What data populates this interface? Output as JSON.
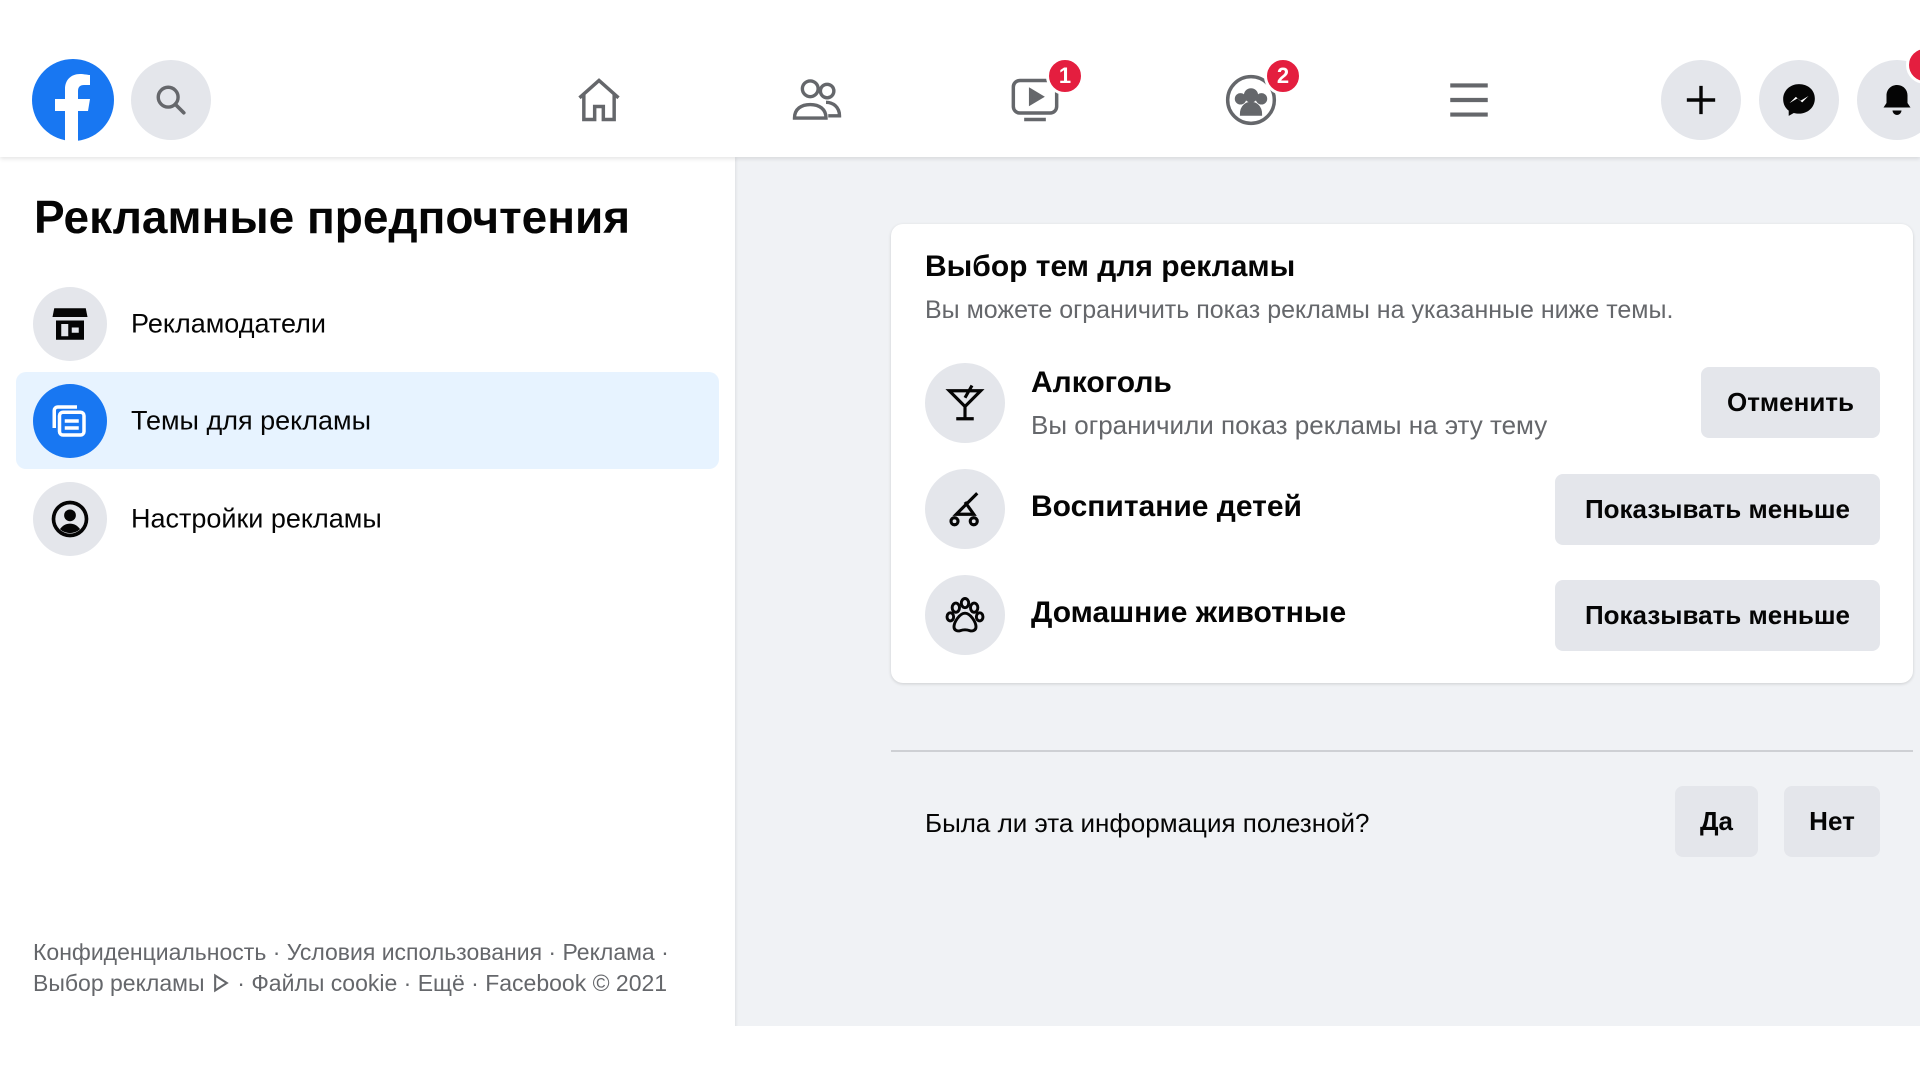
{
  "header": {
    "nav": [
      {
        "name": "home"
      },
      {
        "name": "friends"
      },
      {
        "name": "watch",
        "badge": "1"
      },
      {
        "name": "groups",
        "badge": "2"
      },
      {
        "name": "menu"
      }
    ]
  },
  "sidebar": {
    "title": "Рекламные предпочтения",
    "items": [
      {
        "label": "Рекламодатели",
        "icon": "store-icon"
      },
      {
        "label": "Темы для рекламы",
        "icon": "topics-icon",
        "selected": true
      },
      {
        "label": "Настройки рекламы",
        "icon": "user-circle-icon"
      }
    ]
  },
  "footer": {
    "line1": "Конфиденциальность · Условия использования · Реклама ·",
    "line2a": "Выбор рекламы",
    "line2b": " · Файлы cookie · Ещё · Facebook © 2021"
  },
  "card": {
    "title": "Выбор тем для рекламы",
    "subtitle": "Вы можете ограничить показ рекламы на указанные ниже темы.",
    "topics": [
      {
        "label": "Алкоголь",
        "sub": "Вы ограничили показ рекламы на эту тему",
        "button": "Отменить"
      },
      {
        "label": "Воспитание детей",
        "button": "Показывать меньше"
      },
      {
        "label": "Домашние животные",
        "button": "Показывать меньше"
      }
    ]
  },
  "feedback": {
    "question": "Была ли эта информация полезной?",
    "yes": "Да",
    "no": "Нет"
  },
  "colors": {
    "brand": "#1877f2",
    "badge": "#e41e3f",
    "selected": "#e7f3ff"
  }
}
